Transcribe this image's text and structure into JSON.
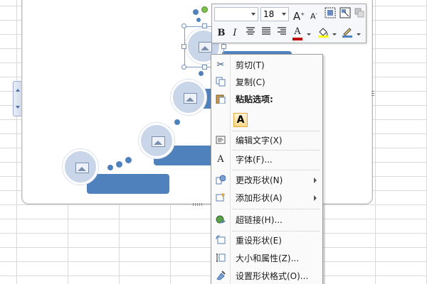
{
  "toolbar": {
    "font_name": "",
    "font_size": "18",
    "grow_font_label": "A",
    "shrink_font_label": "A",
    "bold_label": "B",
    "italic_label": "I",
    "font_color_label": "A",
    "font_color": "#c00000",
    "fill_color": "#ffff00",
    "line_color": "#4f81bd"
  },
  "context_menu": {
    "items": [
      {
        "label": "剪切(T)",
        "icon": "scissors-icon"
      },
      {
        "label": "复制(C)",
        "icon": "copy-icon"
      },
      {
        "label": "粘贴选项:",
        "icon": "paste-icon"
      },
      {
        "label": "编辑文字(X)",
        "icon": "edit-text-icon"
      },
      {
        "label": "字体(F)...",
        "icon": "font-icon"
      },
      {
        "label": "更改形状(N)",
        "icon": "change-shape-icon"
      },
      {
        "label": "添加形状(A)",
        "icon": "add-shape-icon"
      },
      {
        "label": "超链接(H)...",
        "icon": "hyperlink-icon"
      },
      {
        "label": "重设形状(E)",
        "icon": "reset-shape-icon"
      },
      {
        "label": "大小和属性(Z)...",
        "icon": "size-properties-icon"
      },
      {
        "label": "设置形状格式(O)...",
        "icon": "format-shape-icon"
      }
    ],
    "paste_option_label": "A"
  },
  "colors": {
    "accent_bar": "#4f81bd",
    "circle_fill": "#c9d5e9"
  }
}
